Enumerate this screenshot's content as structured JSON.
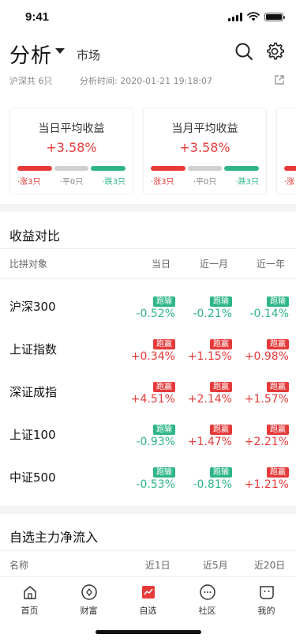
{
  "status_bar": {
    "time": "9:41"
  },
  "header": {
    "title": "分析",
    "market_tab": "市场"
  },
  "meta": {
    "count": "沪深共 6只",
    "analysis_time": "分析时间: 2020-01-21 19:18:07"
  },
  "summary_cards": [
    {
      "title": "当日平均收益",
      "value": "+3.58%",
      "up": "·涨3只",
      "flat": "·平0只",
      "down": "·跌3只"
    },
    {
      "title": "当月平均收益",
      "value": "+3.58%",
      "up": "·涨3只",
      "flat": "·平0只",
      "down": "·跌3只"
    },
    {
      "up": "·涨"
    }
  ],
  "colors": {
    "up": "#e63a3a",
    "flat": "#cfcfcf",
    "down": "#2fb58a"
  },
  "comparison": {
    "title": "收益对比",
    "columns": [
      "比拼对象",
      "当日",
      "近一月",
      "近一年"
    ],
    "rows": [
      {
        "name": "沪深300",
        "cells": [
          {
            "tag": "跑输",
            "value": "-0.52%"
          },
          {
            "tag": "跑输",
            "value": "-0.21%"
          },
          {
            "tag": "跑输",
            "value": "-0.14%"
          }
        ]
      },
      {
        "name": "上证指数",
        "cells": [
          {
            "tag": "跑赢",
            "value": "+0.34%"
          },
          {
            "tag": "跑赢",
            "value": "+1.15%"
          },
          {
            "tag": "跑赢",
            "value": "+0.98%"
          }
        ]
      },
      {
        "name": "深证成指",
        "cells": [
          {
            "tag": "跑赢",
            "value": "+4.51%"
          },
          {
            "tag": "跑赢",
            "value": "+2.14%"
          },
          {
            "tag": "跑赢",
            "value": "+1.57%"
          }
        ]
      },
      {
        "name": "上证100",
        "cells": [
          {
            "tag": "跑输",
            "value": "-0.93%"
          },
          {
            "tag": "跑赢",
            "value": "+1.47%"
          },
          {
            "tag": "跑赢",
            "value": "+2.21%"
          }
        ]
      },
      {
        "name": "中证500",
        "cells": [
          {
            "tag": "跑输",
            "value": "-0.53%"
          },
          {
            "tag": "跑输",
            "value": "-0.81%"
          },
          {
            "tag": "跑赢",
            "value": "+1.21%"
          }
        ]
      }
    ]
  },
  "net_inflow": {
    "title": "自选主力净流入",
    "columns": [
      "名称",
      "近1日",
      "近5月",
      "近20日"
    ]
  },
  "tabbar": [
    {
      "label": "首页",
      "icon": "home-icon"
    },
    {
      "label": "财富",
      "icon": "wealth-icon"
    },
    {
      "label": "自选",
      "icon": "watchlist-icon",
      "active": true
    },
    {
      "label": "社区",
      "icon": "community-icon"
    },
    {
      "label": "我的",
      "icon": "profile-icon"
    }
  ]
}
